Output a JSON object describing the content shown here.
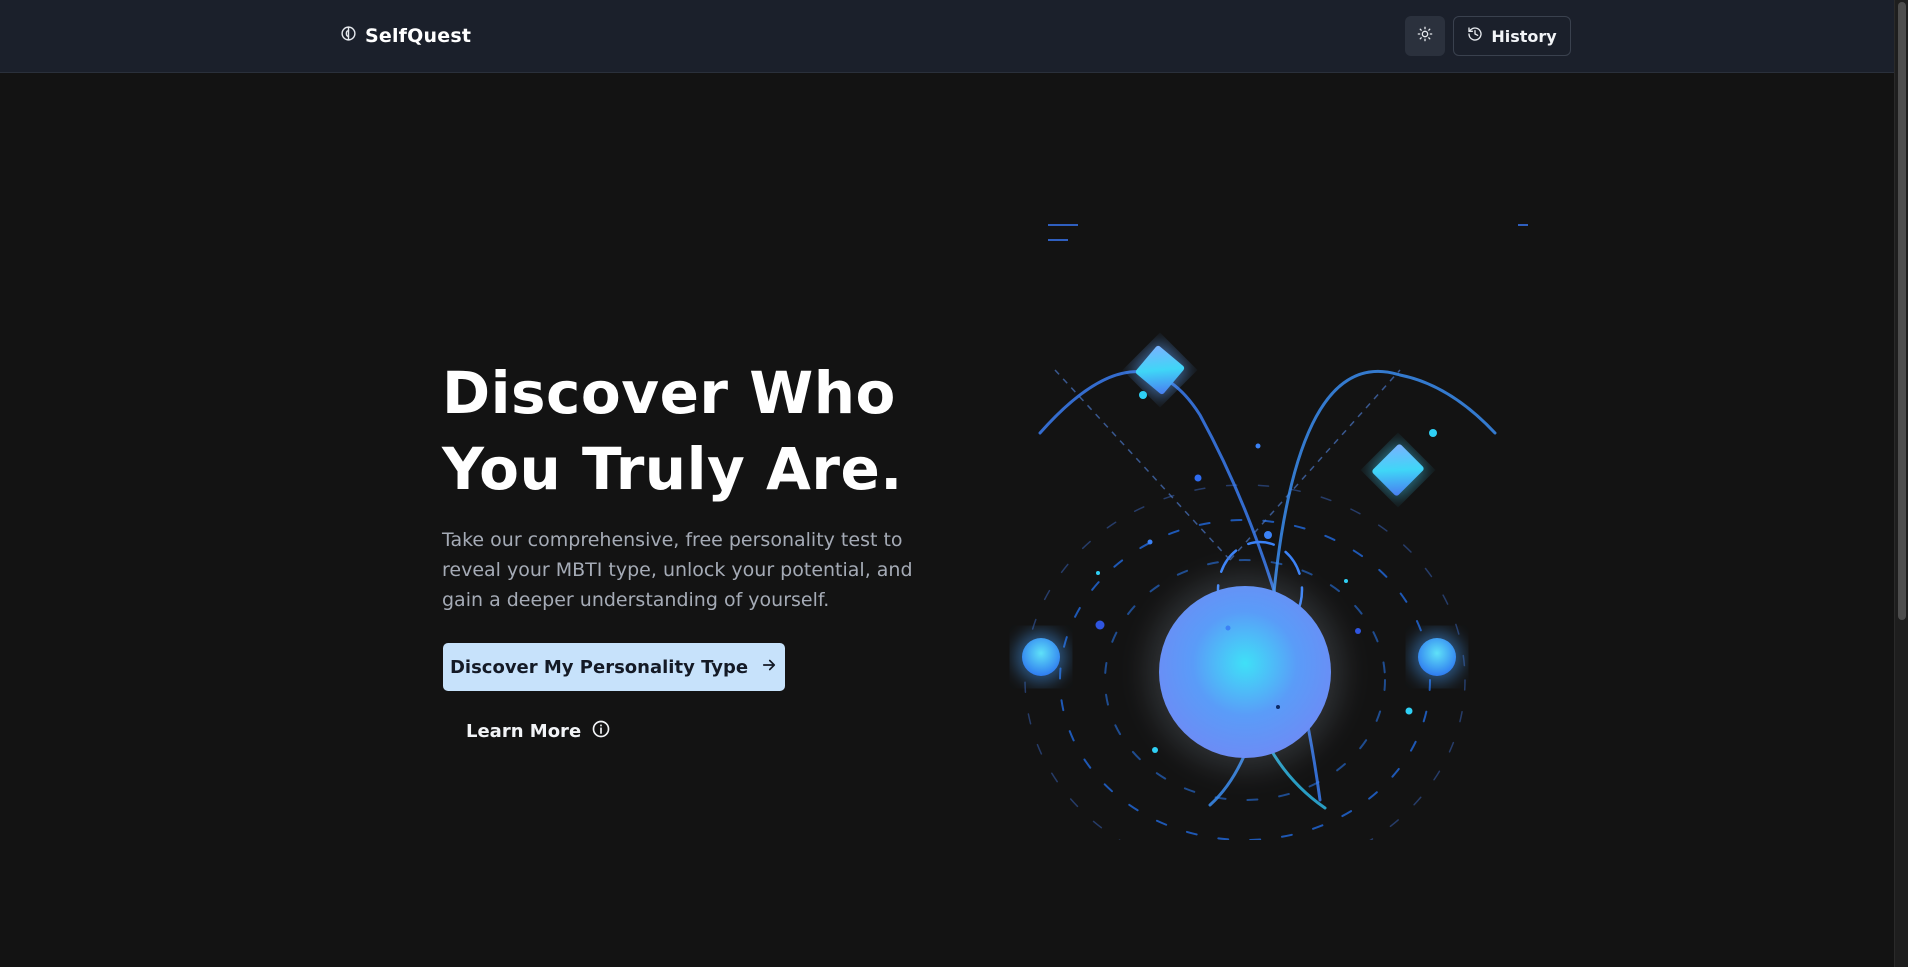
{
  "header": {
    "brand_name": "SelfQuest",
    "history_label": "History"
  },
  "hero": {
    "title_line1": "Discover Who",
    "title_line2": "You Truly Are.",
    "subtitle": "Take our comprehensive, free personality test to reveal your MBTI type, unlock your potential, and gain a deeper understanding of yourself.",
    "primary_cta": "Discover My Personality Type",
    "secondary_cta": "Learn More"
  },
  "icons": {
    "brand": "brain-icon",
    "theme": "sun-icon",
    "history": "history-icon",
    "primary_cta": "arrow-right-icon",
    "secondary_cta": "info-icon"
  },
  "colors": {
    "background": "#131313",
    "header": "#1b202b",
    "primary_button": "#c7e2fb",
    "accent_blue": "#4f8ff7",
    "accent_cyan": "#2fd0f5"
  }
}
